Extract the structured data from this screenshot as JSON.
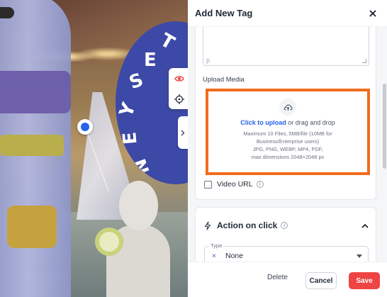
{
  "panel": {
    "title": "Add New Tag",
    "textarea_tag": "p",
    "upload_label": "Upload Media",
    "dropzone": {
      "link_text": "Click to upload",
      "rest_text": "or drag and drop",
      "hint_line1": "Maximum 10 Files, 5MB/file (10MB for",
      "hint_line2": "Business/Enterprise users)",
      "hint_line3": "JPG, PNG, WEBP, MP4, PDF,",
      "hint_line4": "max dimensions 2048×2048 px"
    },
    "video_url_label": "Video URL",
    "action_title": "Action on click",
    "type_label": "Type",
    "type_value": "None",
    "type_clear": "×"
  },
  "footer": {
    "delete_label": "Delete",
    "cancel_label": "Cancel",
    "save_label": "Save"
  },
  "scene": {
    "sign_letters": [
      "T",
      "E",
      "S",
      "Y",
      "E",
      "N"
    ]
  },
  "colors": {
    "accent_blue": "#2563eb",
    "highlight_orange": "#f26b1d",
    "save_red": "#ef4444"
  },
  "icons": {
    "close": "close-icon",
    "upload": "cloud-upload-icon",
    "info": "info-icon",
    "action": "lightning-icon",
    "chevron": "chevron-up-icon",
    "eye": "eye-icon",
    "target": "crosshair-icon"
  }
}
